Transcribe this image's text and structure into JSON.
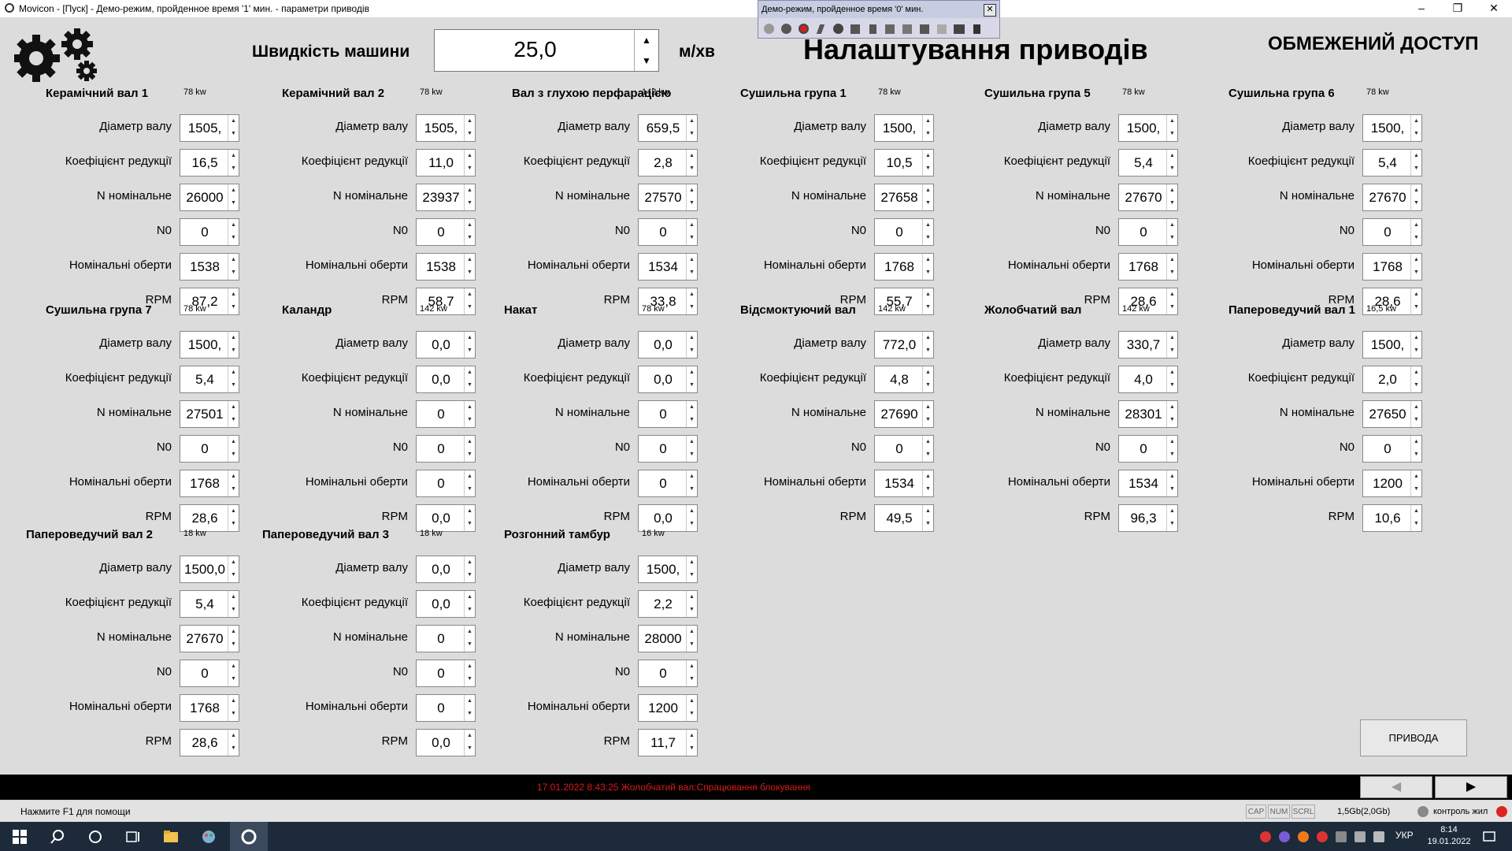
{
  "window": {
    "title": "Movicon - [Пуск] - Демо-режим, пройденное время '1' мин. - параметри приводів",
    "minimize": "–",
    "restore": "❐",
    "close": "✕"
  },
  "demo_popup": {
    "title": "Демо-режим, пройденное время '0' мин.",
    "close": "✕"
  },
  "header": {
    "speed_label": "Швидкість машини",
    "speed_value": "25,0",
    "speed_unit": "м/хв",
    "page_title": "Налаштування приводів",
    "access": "ОБМЕЖЕНИЙ ДОСТУП"
  },
  "spin": {
    "up": "▲",
    "down": "▼"
  },
  "labels": {
    "diameter": "Діаметр валу",
    "reduction": "Коефіцієнт редукції",
    "n_nominal": "N номінальне",
    "n0": "N0",
    "nominal_rpm": "Номінальні оберти",
    "rpm": "RPM"
  },
  "drives": [
    {
      "name": "Керамічний вал 1",
      "kw": "78 kw",
      "values": [
        "1505,",
        "16,5",
        "26000",
        "0",
        "1538",
        "87,2"
      ]
    },
    {
      "name": "Керамічний вал 2",
      "kw": "78 kw",
      "values": [
        "1505,",
        "11,0",
        "23937",
        "0",
        "1538",
        "58,7"
      ]
    },
    {
      "name": "Вал з глухою перфарацією",
      "kw": "142 kw",
      "values": [
        "659,5",
        "2,8",
        "27570",
        "0",
        "1534",
        "33,8"
      ]
    },
    {
      "name": "Сушильна група 1",
      "kw": "78 kw",
      "values": [
        "1500,",
        "10,5",
        "27658",
        "0",
        "1768",
        "55,7"
      ]
    },
    {
      "name": "Сушильна група 5",
      "kw": "78 kw",
      "values": [
        "1500,",
        "5,4",
        "27670",
        "0",
        "1768",
        "28,6"
      ]
    },
    {
      "name": "Сушильна група 6",
      "kw": "78 kw",
      "values": [
        "1500,",
        "5,4",
        "27670",
        "0",
        "1768",
        "28,6"
      ]
    },
    {
      "name": "Сушильна група 7",
      "kw": "78 kw",
      "values": [
        "1500,",
        "5,4",
        "27501",
        "0",
        "1768",
        "28,6"
      ]
    },
    {
      "name": "Каландр",
      "kw": "142 kw",
      "values": [
        "0,0",
        "0,0",
        "0",
        "0",
        "0",
        "0,0"
      ]
    },
    {
      "name": "Накат",
      "kw": "78 kw",
      "values": [
        "0,0",
        "0,0",
        "0",
        "0",
        "0",
        "0,0"
      ]
    },
    {
      "name": "Відсмоктуючий вал",
      "kw": "142 kw",
      "values": [
        "772,0",
        "4,8",
        "27690",
        "0",
        "1534",
        "49,5"
      ]
    },
    {
      "name": "Жолобчатий вал",
      "kw": "142 kw",
      "values": [
        "330,7",
        "4,0",
        "28301",
        "0",
        "1534",
        "96,3"
      ]
    },
    {
      "name": "Папероведучий вал 1",
      "kw": "16,5 kw",
      "values": [
        "1500,",
        "2,0",
        "27650",
        "0",
        "1200",
        "10,6"
      ]
    },
    {
      "name": "Папероведучий вал 2",
      "kw": "18 kw",
      "values": [
        "1500,0",
        "5,4",
        "27670",
        "0",
        "1768",
        "28,6"
      ]
    },
    {
      "name": "Папероведучий вал 3",
      "kw": "18 kw",
      "values": [
        "0,0",
        "0,0",
        "0",
        "0",
        "0",
        "0,0"
      ]
    },
    {
      "name": "Розгонний тамбур",
      "kw": "16 kw",
      "values": [
        "1500,",
        "2,2",
        "28000",
        "0",
        "1200",
        "11,7"
      ]
    }
  ],
  "buttons": {
    "drives": "ПРИВОДА",
    "prev": "◀",
    "next": "▶"
  },
  "alarm": {
    "text": "17.01.2022 8:43:25 Жолобчатий вал:Спрацювання блокування"
  },
  "statusbar": {
    "help": "Нажмите F1 для помощи",
    "cap": "CAP",
    "num": "NUM",
    "scrl": "SCRL",
    "memory": "1,5Gb(2,0Gb)",
    "user": "контроль жил"
  },
  "taskbar": {
    "lang": "УКР",
    "time": "8:14",
    "date": "19.01.2022"
  },
  "colors": {
    "alarm_text": "#d81c1c",
    "background": "#dcdcdc"
  }
}
